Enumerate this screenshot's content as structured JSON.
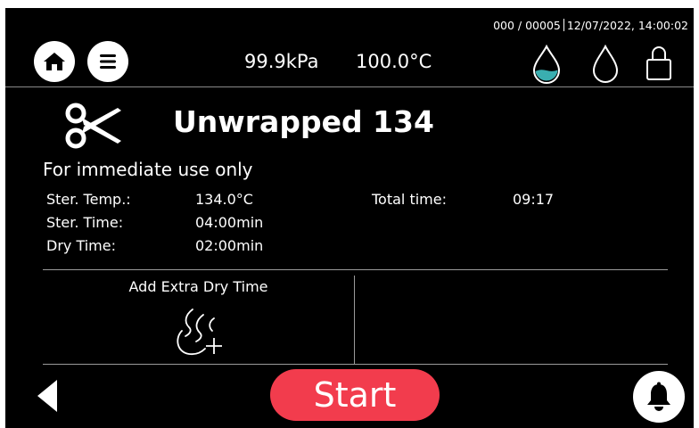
{
  "status_bar": {
    "cycle_counter": "000 / 00005",
    "datetime": "12/07/2022, 14:00:02"
  },
  "header": {
    "pressure": "99.9kPa",
    "temperature": "100.0°C",
    "icons": [
      "home-icon",
      "menu-icon",
      "water-drop-filled-icon",
      "water-drop-outline-icon",
      "lock-icon"
    ]
  },
  "program": {
    "name": "Unwrapped 134",
    "icon": "scissors-icon",
    "subtitle": "For immediate use only",
    "params": {
      "ster_temp_label": "Ster. Temp.:",
      "ster_temp_value": "134.0°C",
      "ster_time_label": "Ster. Time:",
      "ster_time_value": "04:00min",
      "dry_time_label": "Dry Time:",
      "dry_time_value": "02:00min",
      "total_time_label": "Total time:",
      "total_time_value": "09:17"
    }
  },
  "options": {
    "extra_dry_label": "Add Extra Dry Time"
  },
  "footer": {
    "start_label": "Start"
  },
  "colors": {
    "background": "#000000",
    "accent_start": "#f23c4d",
    "water_teal": "#3aaeb0"
  }
}
